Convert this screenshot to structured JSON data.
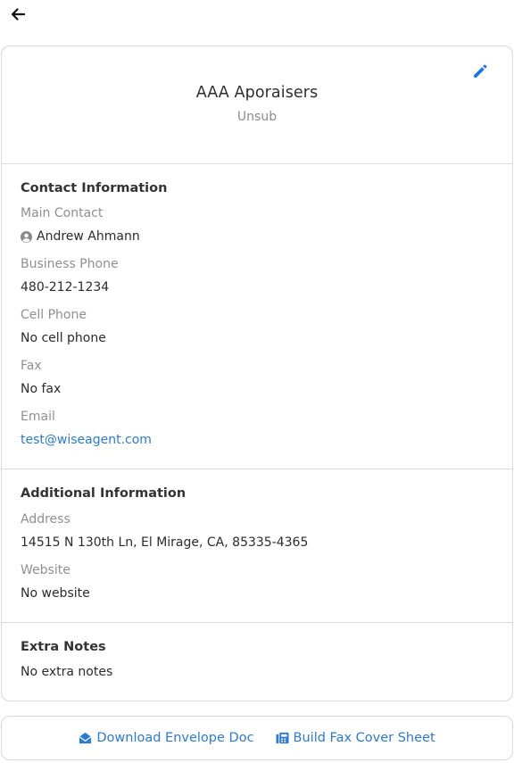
{
  "contact": {
    "company_name": "AAA Aporaisers",
    "status": "Unsub"
  },
  "contact_info": {
    "title": "Contact Information",
    "main_contact_label": "Main Contact",
    "main_contact_value": "Andrew Ahmann",
    "business_phone_label": "Business Phone",
    "business_phone_value": "480-212-1234",
    "cell_phone_label": "Cell Phone",
    "cell_phone_value": "No cell phone",
    "fax_label": "Fax",
    "fax_value": "No fax",
    "email_label": "Email",
    "email_value": "test@wiseagent.com"
  },
  "additional_info": {
    "title": "Additional Information",
    "address_label": "Address",
    "address_value": "14515 N 130th Ln, El Mirage, CA, 85335-4365",
    "website_label": "Website",
    "website_value": "No website"
  },
  "notes": {
    "title": "Extra Notes",
    "value": "No extra notes"
  },
  "footer": {
    "download_label": "Download Envelope Doc",
    "fax_label": "Build Fax Cover Sheet"
  },
  "colors": {
    "accent": "#2a7bd1",
    "edit_icon": "#1a73e8"
  }
}
